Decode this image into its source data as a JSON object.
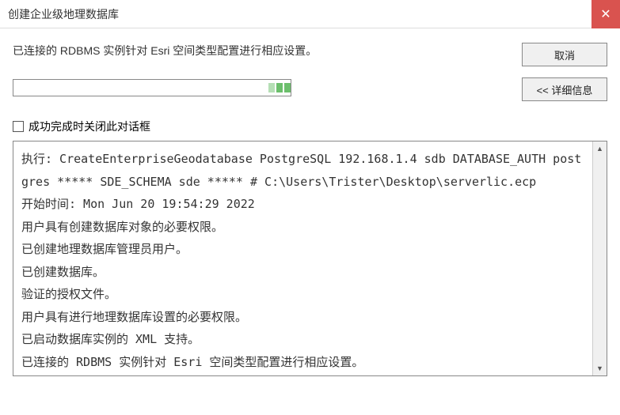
{
  "titlebar": {
    "title": "创建企业级地理数据库"
  },
  "status_message": "已连接的 RDBMS 实例针对 Esri 空间类型配置进行相应设置。",
  "buttons": {
    "cancel": "取消",
    "details": "<< 详细信息"
  },
  "checkbox": {
    "label": "成功完成时关闭此对话框",
    "checked": false
  },
  "log_lines": [
    "执行: CreateEnterpriseGeodatabase PostgreSQL 192.168.1.4 sdb DATABASE_AUTH postgres ***** SDE_SCHEMA sde ***** # C:\\Users\\Trister\\Desktop\\serverlic.ecp",
    "开始时间: Mon Jun 20 19:54:29 2022",
    "用户具有创建数据库对象的必要权限。",
    "已创建地理数据库管理员用户。",
    "已创建数据库。",
    "验证的授权文件。",
    "用户具有进行地理数据库设置的必要权限。",
    "已启动数据库实例的 XML 支持。",
    "已连接的 RDBMS 实例针对 Esri 空间类型配置进行相应设置。"
  ]
}
